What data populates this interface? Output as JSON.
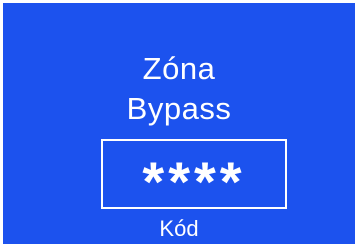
{
  "screen": {
    "title_line_1": "Zóna",
    "title_line_2": "Bypass",
    "code_value": "****",
    "code_label": "Kód",
    "background_color": "#1c52ee",
    "text_color": "#ffffff"
  }
}
